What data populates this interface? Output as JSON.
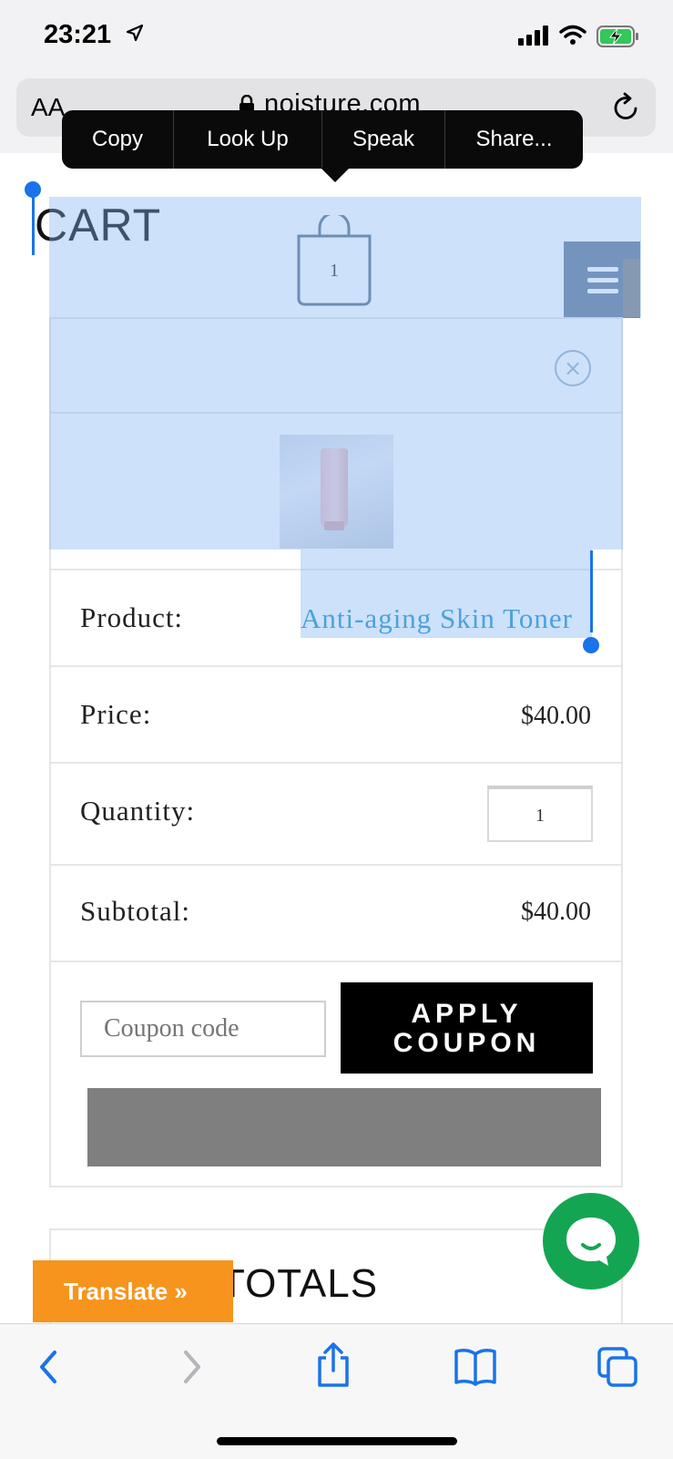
{
  "status_bar": {
    "time": "23:21"
  },
  "browser": {
    "text_size_label": "AA",
    "url": "noisture.com",
    "context_menu": {
      "items": [
        "Copy",
        "Look Up",
        "Speak",
        "Share..."
      ]
    }
  },
  "page": {
    "heading": "CART",
    "cart_count": "1",
    "remove_symbol": "×",
    "rows": {
      "product": {
        "label": "Product:",
        "value": "Anti-aging Skin Toner"
      },
      "price": {
        "label": "Price:",
        "value": "$40.00"
      },
      "quantity": {
        "label": "Quantity:",
        "value": "1"
      },
      "subtotal": {
        "label": "Subtotal:",
        "value": "$40.00"
      }
    },
    "coupon": {
      "placeholder": "Coupon code",
      "button_line1": "APPLY",
      "button_line2": "COUPON"
    },
    "totals_heading": "TOTALS",
    "translate_label": "Translate »"
  },
  "colors": {
    "link": "#2796c9",
    "selection": "#82b4f5",
    "chat": "#14a552",
    "translate": "#f7941d",
    "ios_blue": "#1a73e8"
  },
  "icons": [
    "location-arrow-icon",
    "signal-icon",
    "wifi-icon",
    "battery-charging-icon",
    "lock-icon",
    "reload-icon",
    "shopping-bag-icon",
    "hamburger-menu-icon",
    "remove-circle-icon",
    "chat-bubble-icon",
    "back-icon",
    "forward-icon",
    "share-icon",
    "bookmarks-icon",
    "tabs-icon"
  ]
}
